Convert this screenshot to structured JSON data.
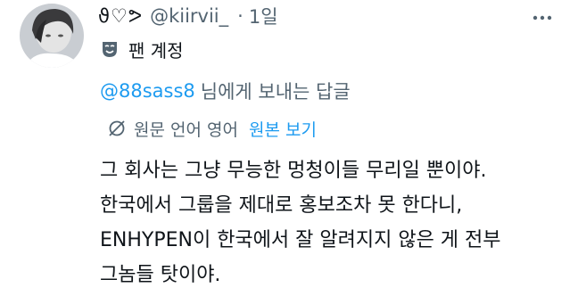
{
  "user": {
    "display_name": "ϑ♡ᕗ",
    "handle": "@kiirvii_",
    "separator": "·",
    "time": "1일",
    "fan_label": "팬 계정"
  },
  "icons": {
    "fan": "mask-icon",
    "translate": "translate-icon",
    "more": "more-dots-icon",
    "avatar": "avatar"
  },
  "reply": {
    "mention": "@88sass8",
    "suffix": "님에게 보내는 답글"
  },
  "translation": {
    "label": "원문 언어 영어",
    "show_original": "원본 보기"
  },
  "body": {
    "lines": [
      "그 회사는 그냥 무능한 멍청이들 무리일 뿐이야.",
      "한국에서 그룹을 제대로 홍보조차 못 한다니,",
      "ENHYPEN이 한국에서 잘 알려지지 않은 게 전부",
      "그놈들 탓이야."
    ]
  },
  "colors": {
    "text": "#0f1419",
    "secondary": "#536471",
    "accent": "#1d9bf0"
  }
}
